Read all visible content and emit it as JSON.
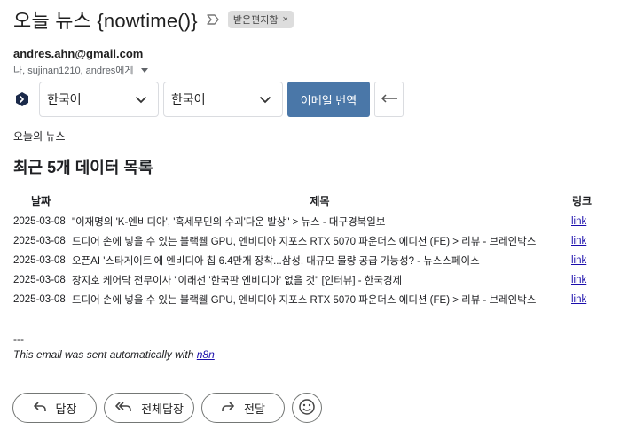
{
  "email": {
    "subject": "오늘 뉴스 {nowtime()}",
    "label": "받은편지함",
    "label_remove": "×",
    "sender": "andres.ahn@gmail.com",
    "recipients": "나, sujinan1210, andres에게"
  },
  "translate": {
    "source_language": "한국어",
    "target_language": "한국어",
    "translate_button": "이메일 번역"
  },
  "body": {
    "greeting": "오늘의 뉴스",
    "heading": "최근 5개 데이터 목록",
    "table": {
      "headers": [
        "날짜",
        "제목",
        "링크"
      ],
      "rows": [
        {
          "date": "2025-03-08",
          "title": "\"이재명의 'K-엔비디아', '혹세무민의 수괴'다운 발상\" > 뉴스 - 대구경북일보",
          "link": "link"
        },
        {
          "date": "2025-03-08",
          "title": "드디어 손에 넣을 수 있는 블랙웰 GPU, 엔비디아 지포스 RTX 5070 파운더스 에디션 (FE) > 리뷰 - 브레인박스",
          "link": "link"
        },
        {
          "date": "2025-03-08",
          "title": "오픈AI '스타게이트'에 엔비디아 칩 6.4만개 장착...삼성, 대규모 물량 공급 가능성? - 뉴스스페이스",
          "link": "link"
        },
        {
          "date": "2025-03-08",
          "title": "장지호 케어닥 전무이사 \"이래선 '한국판 엔비디아' 없을 것\" [인터뷰] - 한국경제",
          "link": "link"
        },
        {
          "date": "2025-03-08",
          "title": "드디어 손에 넣을 수 있는 블랙웰 GPU, 엔비디아 지포스 RTX 5070 파운더스 에디션 (FE) > 리뷰 - 브레인박스",
          "link": "link"
        }
      ]
    },
    "signature_separator": "---",
    "signature_text": "This email was sent automatically with ",
    "signature_link": "n8n"
  },
  "actions": {
    "reply": "답장",
    "reply_all": "전체답장",
    "forward": "전달"
  },
  "icons": {
    "important": "important-marker-icon",
    "translate": "translate-icon",
    "dropdown": "chevron-down-icon",
    "back": "arrow-left-icon",
    "reply": "reply-icon",
    "reply_all": "reply-all-icon",
    "forward": "forward-icon",
    "emoji": "emoji-icon"
  },
  "colors": {
    "translate_button": "#4a77a8",
    "link": "#1a0dab",
    "label_chip": "#dddddd"
  }
}
